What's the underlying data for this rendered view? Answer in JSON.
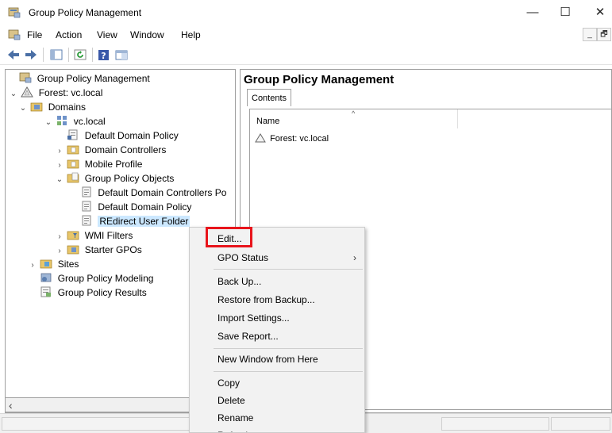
{
  "window": {
    "title": "Group Policy Management",
    "minimize": "—",
    "maximize": "☐",
    "close": "✕"
  },
  "menubar": {
    "items": [
      "File",
      "Action",
      "View",
      "Window",
      "Help"
    ],
    "mdi_min": "_",
    "mdi_restore": "🗗"
  },
  "tree": {
    "root": "Group Policy Management",
    "forest": "Forest: vc.local",
    "domains": "Domains",
    "domain": "vc.local",
    "default_domain_policy_link": "Default Domain Policy",
    "domain_controllers": "Domain Controllers",
    "mobile_profile": "Mobile Profile",
    "gpo_container": "Group Policy Objects",
    "gpo_items": [
      "Default Domain Controllers Po",
      "Default Domain Policy",
      "REdirect User Folder"
    ],
    "wmi_filters": "WMI Filters",
    "starter_gpos": "Starter GPOs",
    "sites": "Sites",
    "modeling": "Group Policy Modeling",
    "results": "Group Policy Results"
  },
  "right": {
    "title": "Group Policy Management",
    "tab": "Contents",
    "column": "Name",
    "rows": [
      "Forest: vc.local"
    ]
  },
  "context_menu": {
    "edit": "Edit...",
    "gpo_status": "GPO Status",
    "back_up": "Back Up...",
    "restore": "Restore from Backup...",
    "import": "Import Settings...",
    "save_report": "Save Report...",
    "new_window": "New Window from Here",
    "copy": "Copy",
    "delete": "Delete",
    "rename": "Rename",
    "refresh": "Refresh"
  },
  "colors": {
    "selection": "#cce8ff",
    "highlight_box": "#e8141b"
  }
}
